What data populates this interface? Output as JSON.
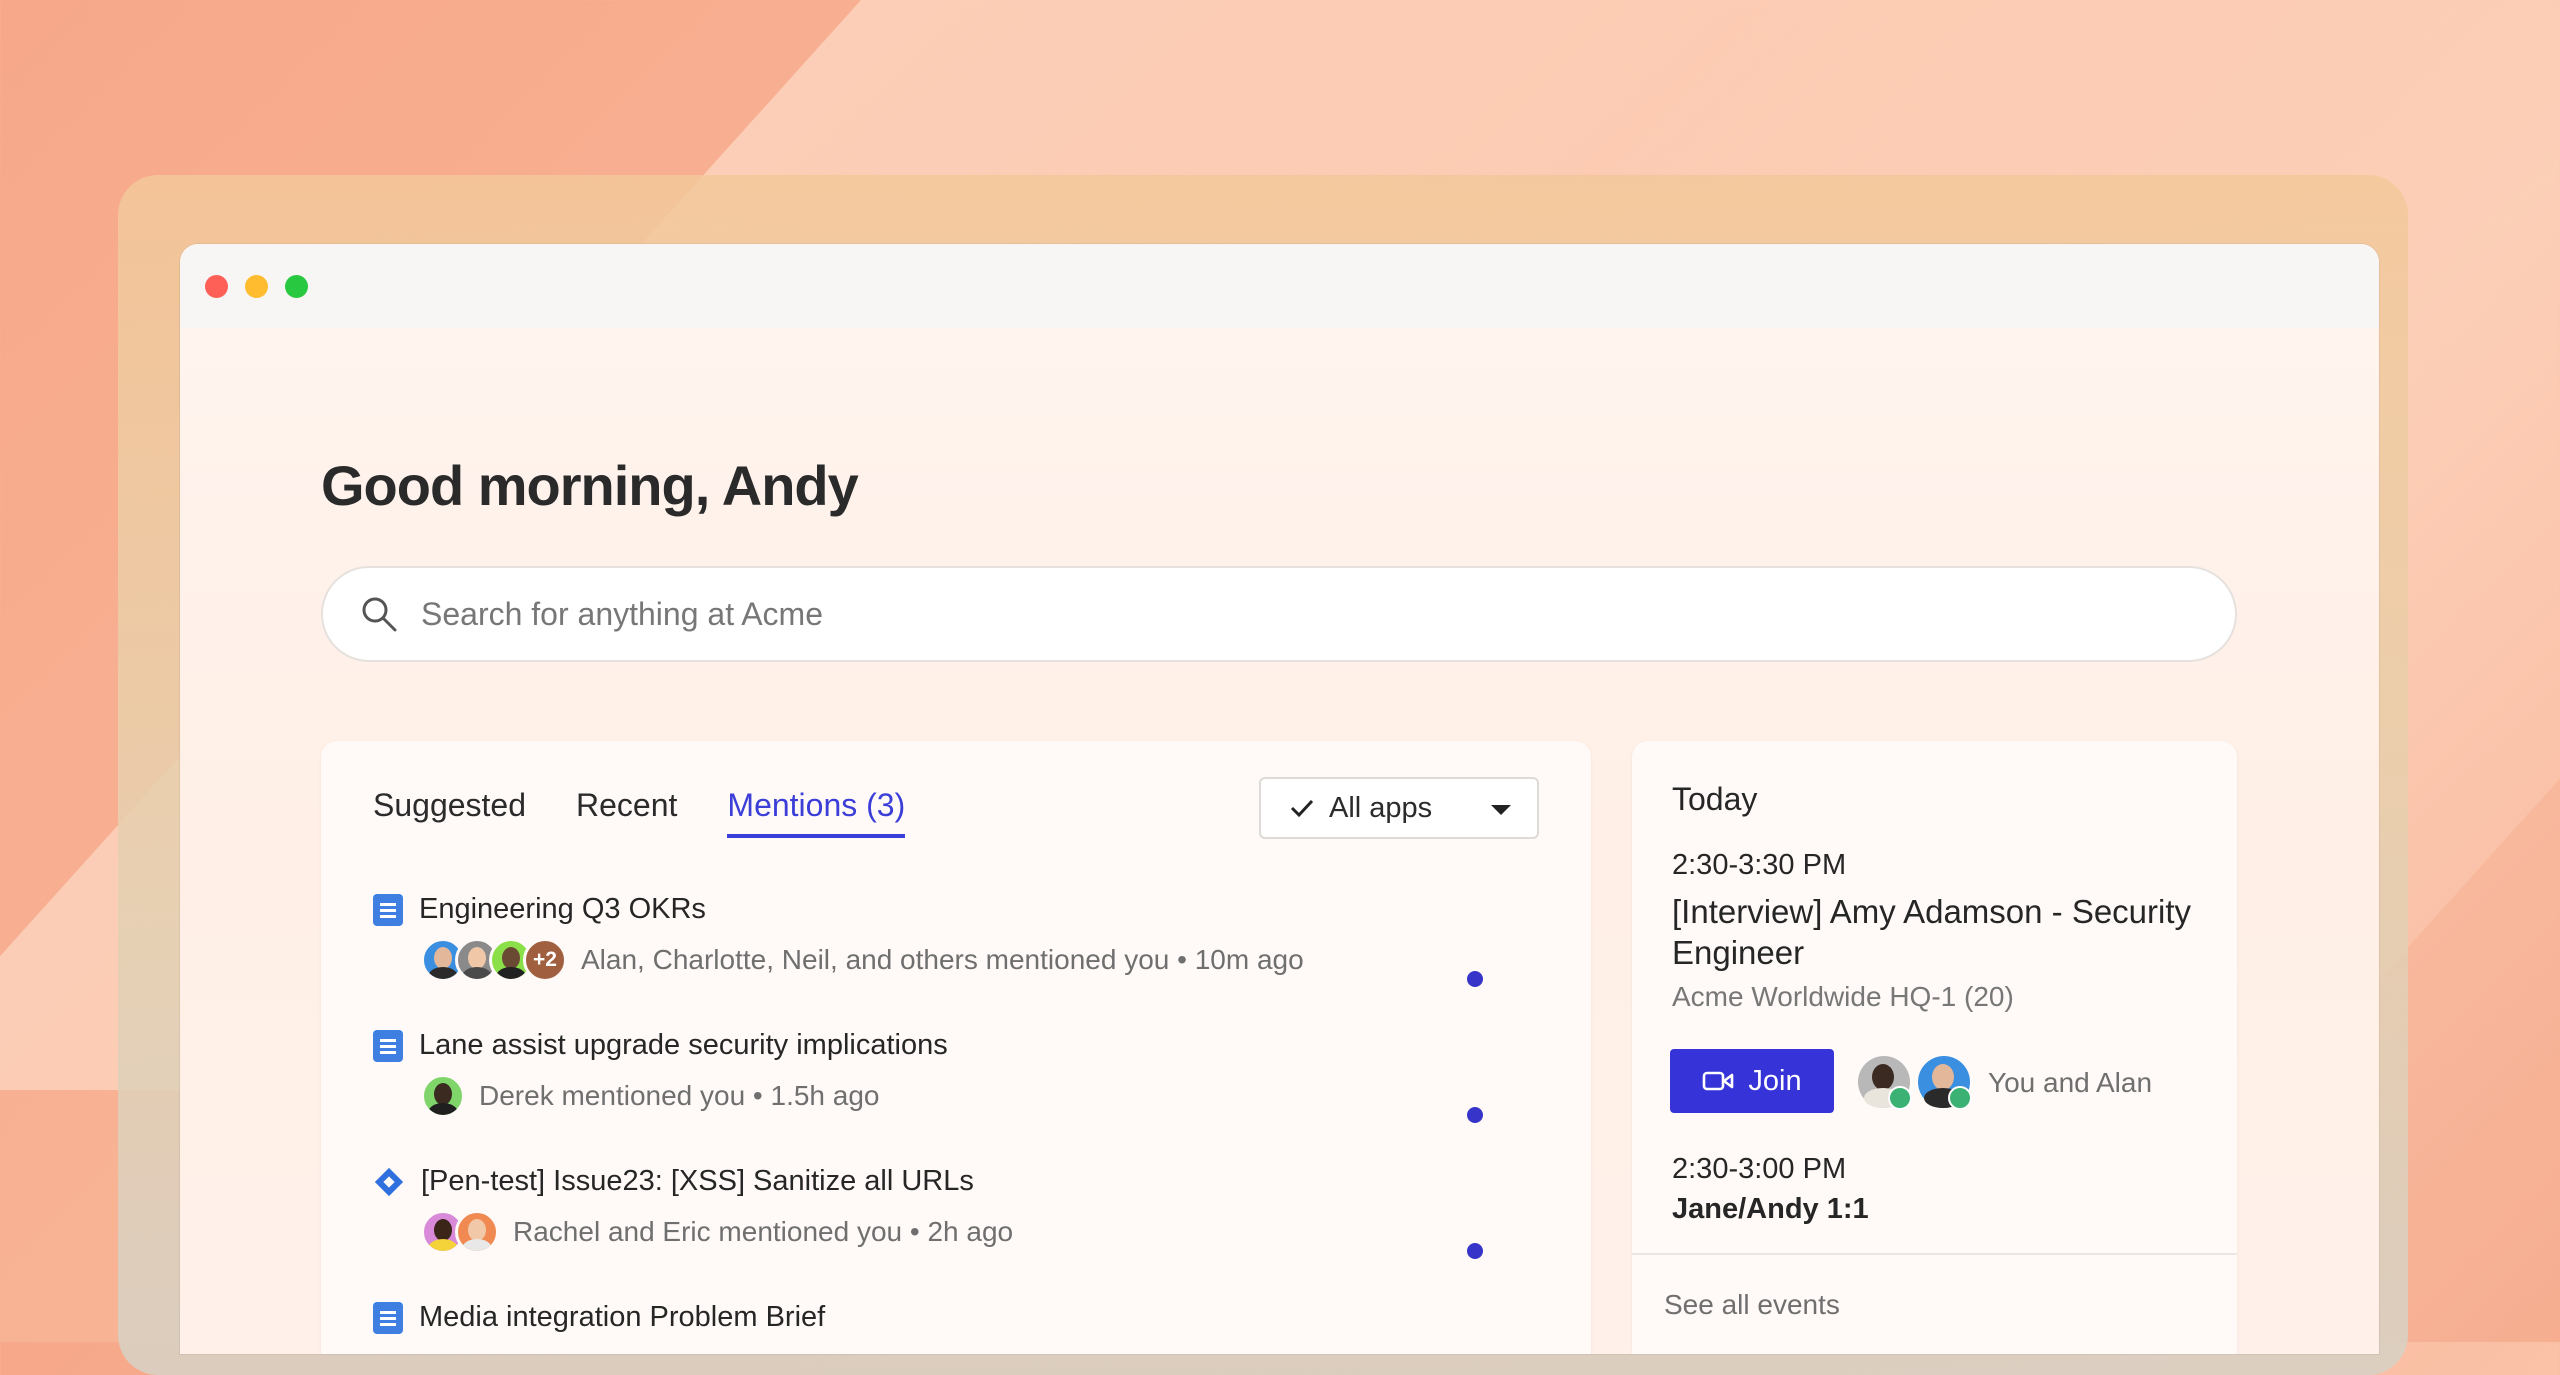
{
  "greeting": "Good morning, Andy",
  "search": {
    "placeholder": "Search for anything at Acme"
  },
  "tabs": [
    {
      "label": "Suggested"
    },
    {
      "label": "Recent"
    },
    {
      "label": "Mentions (3)",
      "active": true
    }
  ],
  "apps_filter": {
    "label": "All apps"
  },
  "mentions": [
    {
      "title": "Engineering Q3 OKRs",
      "meta": "Alan, Charlotte, Neil, and others mentioned you • 10m ago",
      "extra_count": "+2",
      "icon": "doc-icon",
      "unread": true
    },
    {
      "title": "Lane assist upgrade security implications",
      "meta": "Derek mentioned you • 1.5h ago",
      "icon": "doc-icon",
      "unread": true
    },
    {
      "title": "[Pen-test] Issue23: [XSS] Sanitize all URLs",
      "meta": "Rachel and Eric mentioned you • 2h ago",
      "icon": "jira-icon",
      "unread": true
    },
    {
      "title": "Media integration Problem Brief",
      "icon": "doc-icon"
    }
  ],
  "calendar": {
    "heading": "Today",
    "events": [
      {
        "time": "2:30-3:30 PM",
        "title": "[Interview] Amy Adamson - Security Engineer",
        "location": "Acme Worldwide HQ-1 (20)",
        "join_label": "Join",
        "attendees": "You and Alan"
      },
      {
        "time": "2:30-3:00 PM",
        "title": "Jane/Andy 1:1"
      }
    ],
    "see_all": "See all events"
  },
  "colors": {
    "accent": "#3634d9",
    "unread_dot": "#3634c9",
    "doc_icon": "#3f7fe2"
  }
}
